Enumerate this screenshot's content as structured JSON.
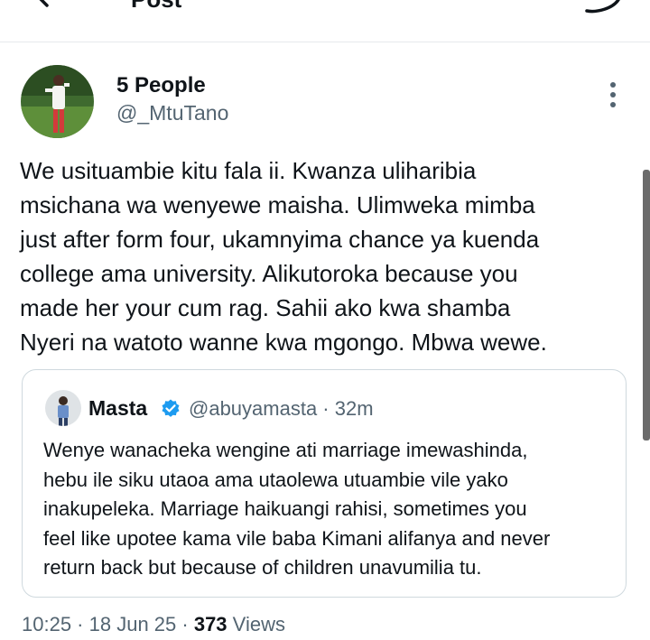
{
  "header": {
    "title": "Post",
    "back_icon": "arrow-left-icon",
    "reply_icon": "reply-icon"
  },
  "tweet": {
    "author_name": "5 People",
    "author_handle": "@_MtuTano",
    "text_lines": [
      "We usituambie kitu fala ii. Kwanza uliharibia",
      "msichana wa wenyewe maisha. Ulimweka mimba",
      "just after form four, ukamnyima chance ya kuenda",
      "college ama university. Alikutoroka because you",
      "made her your cum rag. Sahii ako kwa shamba",
      "Nyeri na watoto wanne kwa mgongo. Mbwa wewe."
    ],
    "time": "10:25",
    "date": "18 Jun 25",
    "views_count": "373",
    "views_label": "Views"
  },
  "quote": {
    "name": "Masta",
    "handle": "@abuyamasta",
    "age": "32m",
    "text_lines": [
      "Wenye wanacheka wengine ati marriage imewashinda,",
      "hebu ile siku utaoa ama utaolewa utuambie vile yako",
      "inakupeleka. Marriage haikuangi rahisi, sometimes you",
      "feel like upotee kama vile baba Kimani alifanya and never",
      "return back but because of children unavumilia tu."
    ]
  },
  "colors": {
    "text": "#0f1419",
    "secondary": "#536471",
    "verified": "#1d9bf0",
    "border": "#cfd9de"
  }
}
